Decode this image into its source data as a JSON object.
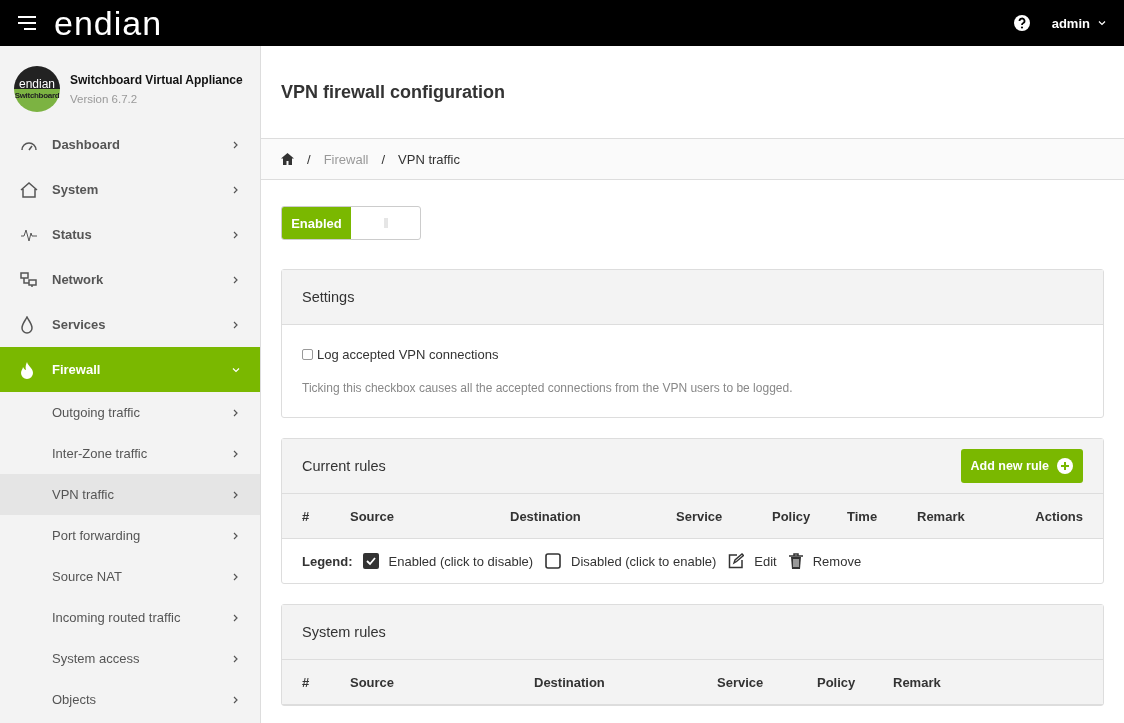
{
  "topbar": {
    "logo": "endian",
    "user": "admin"
  },
  "sidebar": {
    "product": {
      "logo_top": "endian",
      "logo_bottom": "Switchboard",
      "name": "Switchboard Virtual Appliance",
      "version": "Version 6.7.2"
    },
    "items": [
      {
        "label": "Dashboard",
        "expanded": false,
        "selected": false
      },
      {
        "label": "System",
        "expanded": false,
        "selected": false
      },
      {
        "label": "Status",
        "expanded": false,
        "selected": false
      },
      {
        "label": "Network",
        "expanded": false,
        "selected": false
      },
      {
        "label": "Services",
        "expanded": false,
        "selected": false
      },
      {
        "label": "Firewall",
        "expanded": true,
        "selected": true,
        "children": [
          {
            "label": "Outgoing traffic",
            "selected": false
          },
          {
            "label": "Inter-Zone traffic",
            "selected": false
          },
          {
            "label": "VPN traffic",
            "selected": true
          },
          {
            "label": "Port forwarding",
            "selected": false
          },
          {
            "label": "Source NAT",
            "selected": false
          },
          {
            "label": "Incoming routed traffic",
            "selected": false
          },
          {
            "label": "System access",
            "selected": false
          },
          {
            "label": "Objects",
            "selected": false
          }
        ]
      }
    ]
  },
  "page_title": "VPN firewall configuration",
  "breadcrumb": [
    {
      "kind": "separator",
      "text": "/"
    },
    {
      "kind": "link",
      "text": "Firewall"
    },
    {
      "kind": "separator",
      "text": "/"
    },
    {
      "kind": "current",
      "text": "VPN traffic"
    }
  ],
  "toggle": {
    "label": "Enabled",
    "on": true
  },
  "settings": {
    "title": "Settings",
    "checkbox": {
      "label": "Log accepted VPN connections",
      "checked": false
    },
    "help": "Ticking this checkbox causes all the accepted connections from the VPN users to be logged."
  },
  "current_rules": {
    "title": "Current rules",
    "button": "Add new rule",
    "columns": [
      "#",
      "Source",
      "Destination",
      "Service",
      "Policy",
      "Time",
      "Remark",
      "Actions"
    ],
    "legend": {
      "label": "Legend:",
      "items": [
        {
          "kind": "enabled",
          "text": "Enabled (click to disable)"
        },
        {
          "kind": "disabled",
          "text": "Disabled (click to enable)"
        },
        {
          "kind": "edit",
          "text": "Edit"
        },
        {
          "kind": "remove",
          "text": "Remove"
        }
      ]
    }
  },
  "system_rules": {
    "title": "System rules",
    "columns": [
      "#",
      "Source",
      "Destination",
      "Service",
      "Policy",
      "Remark"
    ]
  }
}
